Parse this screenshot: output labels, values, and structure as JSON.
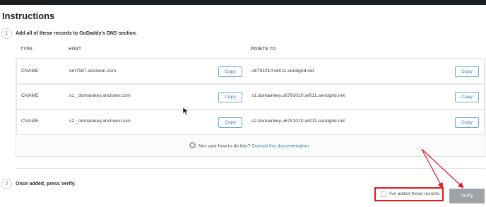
{
  "page": {
    "title": "Instructions"
  },
  "steps": [
    {
      "number": "1",
      "text": "Add all of these records to GoDaddy's DNS section."
    },
    {
      "number": "2",
      "text": "Once added, press Verify."
    }
  ],
  "table": {
    "headers": {
      "type": "TYPE",
      "host": "HOST",
      "points_to": "POINTS TO"
    },
    "copy_label": "Copy",
    "rows": [
      {
        "type": "CNAME",
        "host": "em7587.anclown.com",
        "points_to": "u6791010.wl011.sendgrid.net"
      },
      {
        "type": "CNAME",
        "host": "s1._domainkey.anclown.com",
        "points_to": "s1.domainkey.u6791010.wl011.sendgrid.net"
      },
      {
        "type": "CNAME",
        "host": "s2._domainkey.anclown.com",
        "points_to": "s2.domainkey.u6791010.wl011.sendgrid.net"
      }
    ]
  },
  "help": {
    "text": "Not sure how to do this?",
    "link": "Consult the documentation"
  },
  "confirm": {
    "label": "I've added these records.",
    "checked": false
  },
  "verify": {
    "label": "Verify"
  },
  "colors": {
    "annotation": "#e0171d",
    "link": "#3b82c4",
    "verify_disabled": "#9ea3a7"
  }
}
